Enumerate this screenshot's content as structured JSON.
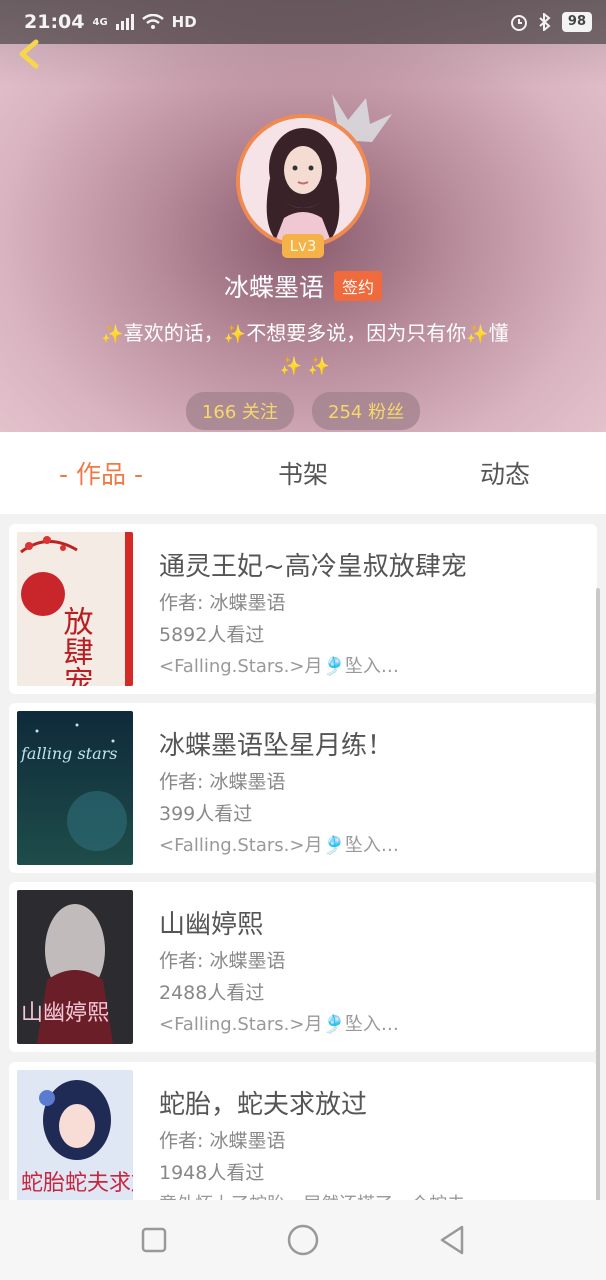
{
  "status_bar": {
    "time": "21:04",
    "network": "4G",
    "hd": "HD",
    "battery": "98"
  },
  "profile": {
    "level": "Lv3",
    "name": "冰蝶墨语",
    "signed_badge": "签约",
    "bio_part1": "喜欢的话，",
    "bio_part2": "不想要多说，因为只有你",
    "bio_part3": "懂",
    "following": "166 关注",
    "followers": "254 粉丝"
  },
  "tabs": [
    {
      "label": "- 作品 -",
      "active": true
    },
    {
      "label": "书架",
      "active": false
    },
    {
      "label": "动态",
      "active": false
    }
  ],
  "books": [
    {
      "title": "通灵王妃~高冷皇叔放肆宠",
      "author": "作者: 冰蝶墨语",
      "views": "5892人看过",
      "desc": "<Falling.Stars.>月🎐坠入…",
      "cover_text": "放肆宠"
    },
    {
      "title": "冰蝶墨语坠星月练！",
      "author": "作者: 冰蝶墨语",
      "views": "399人看过",
      "desc": "<Falling.Stars.>月🎐坠入…",
      "cover_text": "falling stars"
    },
    {
      "title": "山幽婷熙",
      "author": "作者: 冰蝶墨语",
      "views": "2488人看过",
      "desc": "<Falling.Stars.>月🎐坠入…",
      "cover_text": "山幽婷熙"
    },
    {
      "title": "蛇胎，蛇夫求放过",
      "author": "作者: 冰蝶墨语",
      "views": "1948人看过",
      "desc": "意外怀上了蛇胎，居然还搭了一个蛇夫",
      "cover_text": "蛇胎蛇夫求放过"
    }
  ],
  "colors": {
    "accent": "#ef7a45",
    "level_badge": "#f4b248",
    "signed_badge": "#ef6a3c",
    "pill_text": "#f7d86b"
  }
}
